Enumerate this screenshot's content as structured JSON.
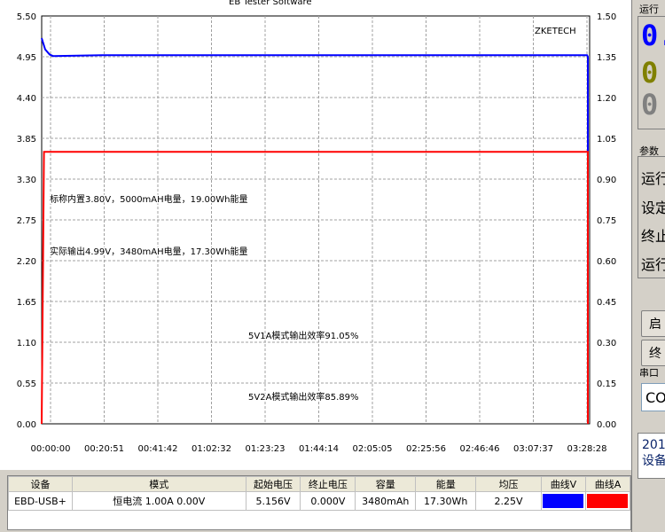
{
  "window": {
    "title_fragment": "EB Tester Software"
  },
  "chart_data": {
    "type": "line",
    "watermark": "ZKETECH",
    "x_ticks": [
      "00:00:00",
      "00:20:51",
      "00:41:42",
      "01:02:32",
      "01:23:23",
      "01:44:14",
      "02:05:05",
      "02:25:56",
      "02:46:46",
      "03:07:37",
      "03:28:28"
    ],
    "y_left_ticks": [
      "5.50",
      "4.95",
      "4.40",
      "3.85",
      "3.30",
      "2.75",
      "2.20",
      "1.65",
      "1.10",
      "0.55",
      "0.00"
    ],
    "y_right_ticks": [
      "1.50",
      "1.35",
      "1.20",
      "1.05",
      "0.90",
      "0.75",
      "0.60",
      "0.45",
      "0.30",
      "0.15",
      "0.00"
    ],
    "ylim_left": [
      0,
      5.5
    ],
    "ylim_right": [
      0,
      1.5
    ],
    "xlim_minutes": [
      0,
      220
    ],
    "grid": true,
    "series": [
      {
        "color": "#0000ff",
        "axis": "left",
        "x_minutes": [
          0,
          0.3,
          0.7,
          1,
          20,
          60,
          120,
          180,
          208.5,
          209,
          209.6,
          210
        ],
        "values": [
          5.2,
          5.05,
          4.98,
          4.96,
          4.97,
          4.97,
          4.97,
          4.97,
          4.97,
          4.95,
          3.6,
          0.0
        ]
      },
      {
        "color": "#ff0000",
        "axis": "right",
        "x_minutes": [
          0,
          0.2,
          209.3,
          209.6
        ],
        "values": [
          0.0,
          1.0,
          1.0,
          0.0
        ]
      }
    ],
    "annotations": [
      "标称内置3.80V，5000mAH电量，19.00Wh能量",
      "实际输出4.99V，3480mAH电量，17.30Wh能量",
      "5V1A模式输出效率91.05%",
      "5V2A模式输出效率85.89%"
    ]
  },
  "right_panel": {
    "label_running": "运行",
    "digit_blue": "0.",
    "digit_olive": "0",
    "digit_gray": "0",
    "label_params": "参数",
    "items": [
      "运行",
      "设定",
      "终止",
      "运行"
    ],
    "btn1": "启",
    "btn2": "终",
    "label_port": "串口",
    "port_value": "CO",
    "info_line1": "201",
    "info_line2": "设备"
  },
  "table": {
    "headers": [
      "设备",
      "模式",
      "起始电压",
      "终止电压",
      "容量",
      "能量",
      "均压",
      "曲线V",
      "曲线A"
    ],
    "row": {
      "device": "EBD-USB+",
      "mode": "恒电流  1.00A  0.00V",
      "start_voltage": "5.156V",
      "end_voltage": "0.000V",
      "capacity": "3480mAh",
      "energy": "17.30Wh",
      "avg_voltage": "2.25V",
      "curve_v_color": "#0000ff",
      "curve_a_color": "#ff0000"
    }
  }
}
